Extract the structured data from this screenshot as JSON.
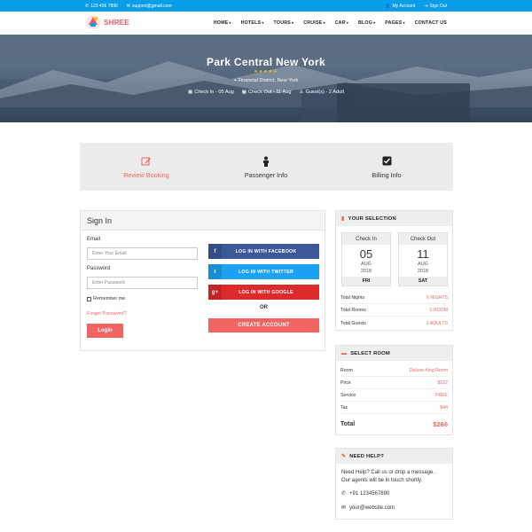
{
  "topbar": {
    "phone": "123 456 7890",
    "email": "support@gmail.com",
    "account": "My Account",
    "signout": "Sign Out"
  },
  "brand": {
    "name": "SHREE"
  },
  "nav": {
    "items": [
      {
        "label": "HOME",
        "caret": true
      },
      {
        "label": "HOTELS",
        "caret": true
      },
      {
        "label": "TOURS",
        "caret": true
      },
      {
        "label": "CRUISE",
        "caret": true
      },
      {
        "label": "CAR",
        "caret": true
      },
      {
        "label": "BLOG",
        "caret": true
      },
      {
        "label": "PAGES",
        "caret": true
      },
      {
        "label": "CONTACT US",
        "caret": false
      }
    ]
  },
  "hero": {
    "title": "Park Central New York",
    "rating": 5,
    "location": "Financial District, New York",
    "check_in": "Check In - 05 Aug",
    "check_out": "Check Out - 11 Aug",
    "guests": "Guest(s) - 2 Adult"
  },
  "steps": [
    {
      "label": "Review Booking",
      "icon": "edit-icon",
      "active": true
    },
    {
      "label": "Passenger Info",
      "icon": "person-icon",
      "active": false
    },
    {
      "label": "Billing Info",
      "icon": "checkbox-icon",
      "active": false
    }
  ],
  "signin": {
    "title": "Sign In",
    "email_label": "Email",
    "email_placeholder": "Enter Your Email",
    "password_label": "Password",
    "password_placeholder": "Enter Password",
    "remember": "Remember me",
    "forgot": "Forget Password?",
    "login": "Login",
    "facebook": "LOG IN WITH FACEBOOK",
    "twitter": "LOG IN WITH TWITTER",
    "google": "LOG IN WITH GOOGLE",
    "or": "OR",
    "create": "CREATE ACCOUNT"
  },
  "selection": {
    "title": "YOUR SELECTION",
    "check_in": {
      "label": "Check In",
      "day": "05",
      "month": "AUG",
      "year": "2018",
      "weekday": "FRI"
    },
    "check_out": {
      "label": "Check Out",
      "day": "11",
      "month": "AUG",
      "year": "2018",
      "weekday": "SAT"
    },
    "rows": [
      {
        "label": "Total Nights",
        "value": "6 NIGHTS"
      },
      {
        "label": "Total Rooms",
        "value": "1 ROOM"
      },
      {
        "label": "Total Guests",
        "value": "2 ADULTS"
      }
    ]
  },
  "room": {
    "title": "SELECT ROOM",
    "rows": [
      {
        "label": "Room",
        "value": "Deluxe King Room"
      },
      {
        "label": "Price",
        "value": "$222"
      },
      {
        "label": "Service",
        "value": "FREE"
      },
      {
        "label": "Tax",
        "value": "$44"
      }
    ],
    "total_label": "Total",
    "total_value": "$266"
  },
  "help": {
    "title": "NEED HELP?",
    "text_line1": "Need Help? Call us or drop a message.",
    "text_line2": "Our agents will be in touch shortly.",
    "phone": "+91 1234567890",
    "email": "your@website.com"
  },
  "colors": {
    "topbar": "#0a9ee8",
    "accent": "#f06464",
    "facebook": "#3b5998",
    "twitter": "#1da1f2",
    "google": "#dd2a2a"
  }
}
